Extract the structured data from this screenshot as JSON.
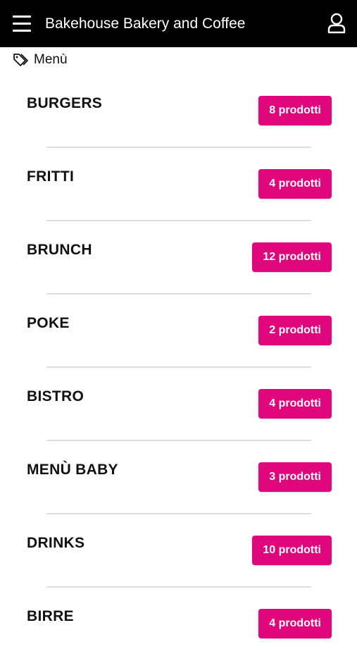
{
  "app": {
    "title": "Bakehouse Bakery and Coffee",
    "bar_color": "#000000",
    "accent_color": "#e0077d"
  },
  "icons": {
    "menu": "hamburger-menu-icon",
    "user": "user-account-icon",
    "section": "tag-icon"
  },
  "section": {
    "label": "Menù"
  },
  "categories": [
    {
      "name": "BURGERS",
      "count_label": "8 prodotti"
    },
    {
      "name": "FRITTI",
      "count_label": "4 prodotti"
    },
    {
      "name": "BRUNCH",
      "count_label": "12 prodotti"
    },
    {
      "name": "POKE",
      "count_label": "2 prodotti"
    },
    {
      "name": "BISTRO",
      "count_label": "4 prodotti"
    },
    {
      "name": "MENÙ BABY",
      "count_label": "3 prodotti"
    },
    {
      "name": "DRINKS",
      "count_label": "10 prodotti"
    },
    {
      "name": "BIRRE",
      "count_label": "4 prodotti"
    }
  ]
}
